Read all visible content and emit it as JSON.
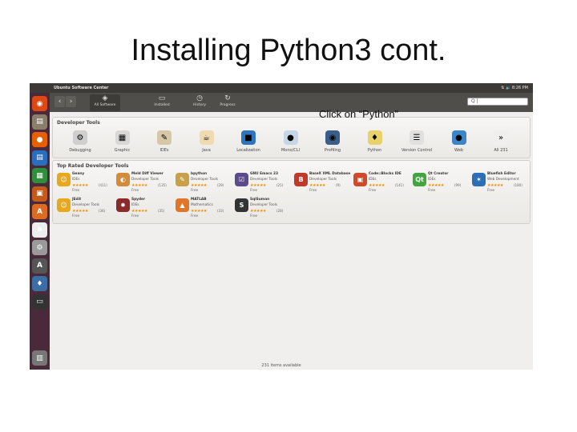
{
  "slide": {
    "title": "Installing Python3 cont.",
    "callout": "Click on “Python”"
  },
  "window": {
    "title": "Ubuntu Software Center",
    "tray_time": "8:26 PM",
    "tray_icons": "⇅  🔉"
  },
  "toolbar": {
    "back": "‹",
    "forward": "›",
    "tools": [
      {
        "label": "All Software",
        "icon": "◈"
      },
      {
        "label": "Installed",
        "icon": "▭"
      },
      {
        "label": "History",
        "icon": "◷"
      },
      {
        "label": "Progress",
        "icon": "↻"
      }
    ],
    "search_value": "Q |"
  },
  "developer_tools": {
    "heading": "Developer Tools",
    "categories": [
      {
        "label": "Debugging",
        "icon": "⚙",
        "color": "#cfcfcf"
      },
      {
        "label": "Graphic",
        "icon": "▦",
        "color": "#d8d8d8"
      },
      {
        "label": "IDEs",
        "icon": "✎",
        "color": "#d6c7a6"
      },
      {
        "label": "Java",
        "icon": "☕",
        "color": "#eedcb0"
      },
      {
        "label": "Localization",
        "icon": "■",
        "color": "#2f74c0"
      },
      {
        "label": "Mono/CLI",
        "icon": "●",
        "color": "#c7d6e6"
      },
      {
        "label": "Profiling",
        "icon": "◉",
        "color": "#3c5d8a"
      },
      {
        "label": "Python",
        "icon": "♦",
        "color": "#e7d36a"
      },
      {
        "label": "Version Control",
        "icon": "☰",
        "color": "#e0e0e0"
      },
      {
        "label": "Web",
        "icon": "●",
        "color": "#3a86c8"
      },
      {
        "label": "All 231",
        "icon": "»",
        "color": "#f1efed"
      }
    ]
  },
  "top_rated": {
    "heading": "Top Rated Developer Tools",
    "apps": [
      {
        "name": "Geany",
        "category": "IDEs",
        "stars": "★★★★★",
        "count": "(411)",
        "price": "Free",
        "icon": "☺",
        "color": "#e8a81c"
      },
      {
        "name": "Meld Diff Viewer",
        "category": "Developer Tools",
        "stars": "★★★★★",
        "count": "(135)",
        "price": "Free",
        "icon": "◐",
        "color": "#d28a3b"
      },
      {
        "name": "bpython",
        "category": "Developer Tools",
        "stars": "★★★★★",
        "count": "(29)",
        "price": "Free",
        "icon": "✎",
        "color": "#c8a14a"
      },
      {
        "name": "GNU Emacs 23",
        "category": "Developer Tools",
        "stars": "★★★★★",
        "count": "(25)",
        "price": "Free",
        "icon": "☑",
        "color": "#5b4a8c"
      },
      {
        "name": "BaseX XML Database",
        "category": "Developer Tools",
        "stars": "★★★★★",
        "count": "(9)",
        "price": "Free",
        "icon": "B",
        "color": "#c0392b"
      },
      {
        "name": "Code::Blocks IDE",
        "category": "IDEs",
        "stars": "★★★★★",
        "count": "(141)",
        "price": "Free",
        "icon": "▣",
        "color": "#d04a2a"
      },
      {
        "name": "Qt Creator",
        "category": "IDEs",
        "stars": "★★★★★",
        "count": "(99)",
        "price": "Free",
        "icon": "Qt",
        "color": "#41a63f"
      },
      {
        "name": "Bluefish Editor",
        "category": "Web Development",
        "stars": "★★★★★",
        "count": "(180)",
        "price": "Free",
        "icon": "✶",
        "color": "#2c6fb6"
      },
      {
        "name": "JEdit",
        "category": "Developer Tools",
        "stars": "★★★★★",
        "count": "(36)",
        "price": "Free",
        "icon": "☺",
        "color": "#e8a81c"
      },
      {
        "name": "Spyder",
        "category": "IDEs",
        "stars": "★★★★★",
        "count": "(35)",
        "price": "Free",
        "icon": "✸",
        "color": "#8b2a2a"
      },
      {
        "name": "MATLAB",
        "category": "Mathematics",
        "stars": "★★★★★",
        "count": "(33)",
        "price": "Free",
        "icon": "▲",
        "color": "#e0762a"
      },
      {
        "name": "SqlSuman",
        "category": "Developer Tools",
        "stars": "★★★★★",
        "count": "(28)",
        "price": "Free",
        "icon": "S",
        "color": "#333333"
      }
    ]
  },
  "footer": {
    "items_count": "231 items available"
  },
  "launcher_icons": [
    {
      "name": "ubuntu-dash-icon",
      "glyph": "◉",
      "color": "#dd4814"
    },
    {
      "name": "files-icon",
      "glyph": "▤",
      "color": "#8a7f6b"
    },
    {
      "name": "firefox-icon",
      "glyph": "●",
      "color": "#e66000"
    },
    {
      "name": "writer-icon",
      "glyph": "▤",
      "color": "#2a6fbf"
    },
    {
      "name": "calc-icon",
      "glyph": "▦",
      "color": "#2f8f3a"
    },
    {
      "name": "impress-icon",
      "glyph": "▣",
      "color": "#c25a1c"
    },
    {
      "name": "software-center-icon",
      "glyph": "A",
      "color": "#dd6b20"
    },
    {
      "name": "amazon-icon",
      "glyph": "a",
      "color": "#eeeeee"
    },
    {
      "name": "settings-icon",
      "glyph": "⚙",
      "color": "#9a9a9a"
    },
    {
      "name": "updater-icon",
      "glyph": "A",
      "color": "#555555"
    },
    {
      "name": "python-icon",
      "glyph": "♦",
      "color": "#3b6ea5"
    },
    {
      "name": "terminal-icon",
      "glyph": "▭",
      "color": "#333333"
    },
    {
      "name": "trash-icon",
      "glyph": "▥",
      "color": "#777777"
    }
  ]
}
